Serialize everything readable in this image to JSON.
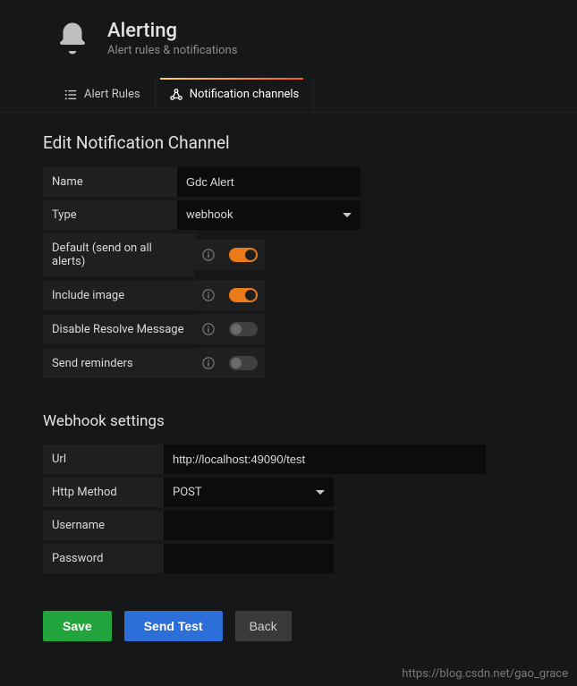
{
  "header": {
    "title": "Alerting",
    "subtitle": "Alert rules & notifications"
  },
  "tabs": {
    "rules": "Alert Rules",
    "channels": "Notification channels"
  },
  "section": {
    "edit_title": "Edit Notification Channel",
    "webhook_title": "Webhook settings"
  },
  "labels": {
    "name": "Name",
    "type": "Type",
    "default": "Default (send on all alerts)",
    "include_image": "Include image",
    "disable_resolve": "Disable Resolve Message",
    "send_reminders": "Send reminders",
    "url": "Url",
    "http_method": "Http Method",
    "username": "Username",
    "password": "Password"
  },
  "values": {
    "name": "Gdc Alert",
    "type": "webhook",
    "url": "http://localhost:49090/test",
    "http_method": "POST",
    "username": "",
    "password": ""
  },
  "toggles": {
    "default": true,
    "include_image": true,
    "disable_resolve": false,
    "send_reminders": false
  },
  "buttons": {
    "save": "Save",
    "send_test": "Send Test",
    "back": "Back"
  },
  "watermark": "https://blog.csdn.net/gao_grace"
}
